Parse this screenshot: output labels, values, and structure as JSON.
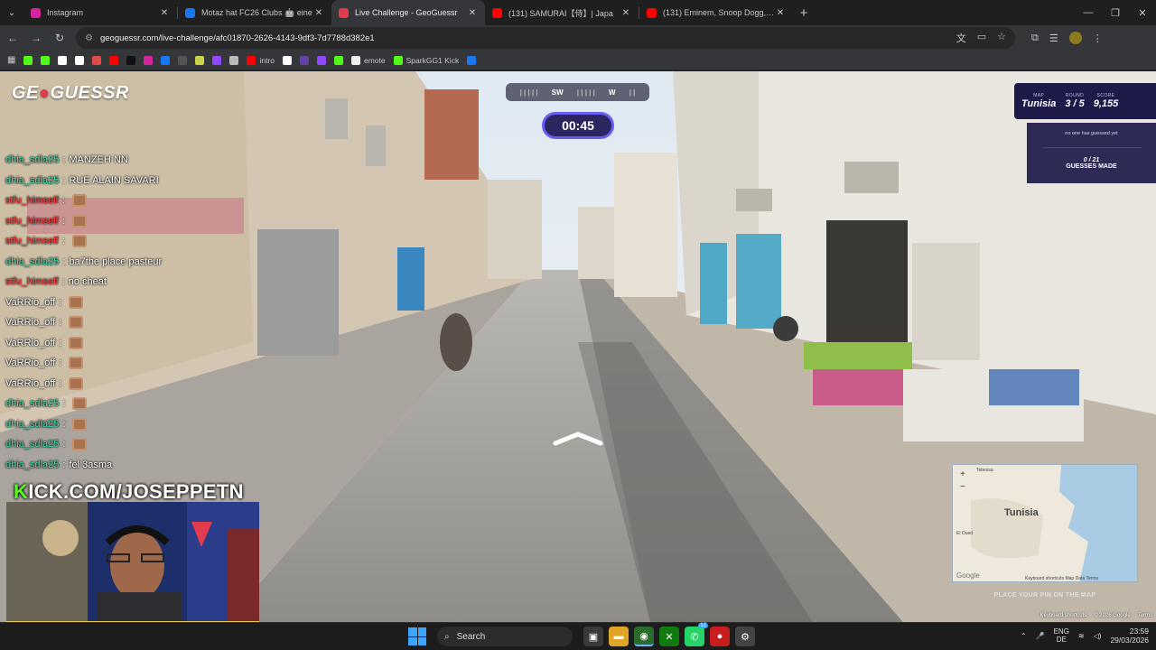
{
  "browser": {
    "tabs": [
      {
        "title": "Instagram",
        "favicon_color": "#d6249f",
        "active": false
      },
      {
        "title": "Motaz hat FC26 Clubs 🤖 eine",
        "favicon_color": "#1877f2",
        "active": false
      },
      {
        "title": "Live Challenge - GeoGuessr",
        "favicon_color": "#e23b4e",
        "active": true
      },
      {
        "title": "(131) SAMURAI【侍】| Japa",
        "favicon_color": "#ff0000",
        "active": false
      },
      {
        "title": "(131) Eminem, Snoop Dogg, 50",
        "favicon_color": "#ff0000",
        "active": false
      }
    ],
    "url": "geoguessr.com/live-challenge/afc01870-2626-4143-9df3-7d7788d382e1",
    "bookmarks": [
      {
        "label": "",
        "color": "#53fc18"
      },
      {
        "label": "",
        "color": "#53fc18"
      },
      {
        "label": "",
        "color": "#ffffff"
      },
      {
        "label": "",
        "color": "#ffffff"
      },
      {
        "label": "",
        "color": "#e04a4a"
      },
      {
        "label": "",
        "color": "#ff0000"
      },
      {
        "label": "",
        "color": "#111111"
      },
      {
        "label": "",
        "color": "#d6249f"
      },
      {
        "label": "",
        "color": "#1877f2"
      },
      {
        "label": "",
        "color": "#555555"
      },
      {
        "label": "",
        "color": "#cbd24b"
      },
      {
        "label": "",
        "color": "#9146ff"
      },
      {
        "label": "",
        "color": "#bbbbbb"
      },
      {
        "label": "intro",
        "color": "#ff0000"
      },
      {
        "label": "",
        "color": "#ffffff"
      },
      {
        "label": "",
        "color": "#6441a5"
      },
      {
        "label": "",
        "color": "#9146ff"
      },
      {
        "label": "",
        "color": "#53fc18"
      },
      {
        "label": "emote",
        "color": "#eeeeee"
      },
      {
        "label": "SparkGG1 Kick",
        "color": "#53fc18"
      },
      {
        "label": "",
        "color": "#1877f2"
      }
    ]
  },
  "game": {
    "logo_text_a": "GE",
    "logo_text_b": "GUESSR",
    "compass": {
      "ticks_left": "| | | | |",
      "label_1": "SW",
      "ticks_mid": "| | | | |",
      "label_2": "W",
      "ticks_right": "| |"
    },
    "timer": "00:45",
    "map_label": "MAP",
    "map_value": "Tunisia",
    "round_label": "ROUND",
    "round_value": "3 / 5",
    "score_label": "SCORE",
    "score_value": "9,155",
    "guess_note": "no one has guessed yet",
    "guess_count": "0 / 21",
    "guess_label": "GUESSES MADE",
    "minimap_country": "Tunisia",
    "minimap_place_1": "Tebessa",
    "minimap_place_2": "El Oued",
    "minimap_google": "Google",
    "minimap_footer": "Keyboard shortcuts   Map Data   Terms",
    "pin_prompt": "PLACE YOUR PIN ON THE MAP",
    "footer_links": [
      "Keyboard shortcuts",
      "© 2026 Google",
      "Terms"
    ]
  },
  "chat": [
    {
      "user": "dhia_sdla25",
      "color": "#38d9a9",
      "text": "MANZEH NN",
      "emote": false
    },
    {
      "user": "dhia_sdla25",
      "color": "#38d9a9",
      "text": "RUE ALAIN SAVARI",
      "emote": false
    },
    {
      "user": "stfu_himself",
      "color": "#ff3b3b",
      "text": "",
      "emote": true
    },
    {
      "user": "stfu_himself",
      "color": "#ff3b3b",
      "text": "",
      "emote": true
    },
    {
      "user": "stfu_himself",
      "color": "#ff3b3b",
      "text": "",
      "emote": true
    },
    {
      "user": "dhia_sdla25",
      "color": "#38d9a9",
      "text": "ba7the place pasteur",
      "emote": false
    },
    {
      "user": "stfu_himself",
      "color": "#ff3b3b",
      "text": "no cheat",
      "emote": false
    },
    {
      "user": "VaRRio_off",
      "color": "#ffffff",
      "text": "",
      "emote": true
    },
    {
      "user": "VaRRio_off",
      "color": "#ffffff",
      "text": "",
      "emote": true
    },
    {
      "user": "VaRRio_off",
      "color": "#ffffff",
      "text": "",
      "emote": true
    },
    {
      "user": "VaRRio_off",
      "color": "#ffffff",
      "text": "",
      "emote": true
    },
    {
      "user": "VaRRio_off",
      "color": "#ffffff",
      "text": "",
      "emote": true
    },
    {
      "user": "dhia_sdla25",
      "color": "#38d9a9",
      "text": "",
      "emote": true
    },
    {
      "user": "dhia_sdla25",
      "color": "#38d9a9",
      "text": "",
      "emote": true
    },
    {
      "user": "dhia_sdla25",
      "color": "#38d9a9",
      "text": "",
      "emote": true
    },
    {
      "user": "dhia_sdla25",
      "color": "#38d9a9",
      "text": "fel 3asma",
      "emote": false
    }
  ],
  "stream": {
    "kick_k": "K",
    "kick_rest": "ICK.COM/JOSEPPETN"
  },
  "taskbar": {
    "search_placeholder": "Search",
    "lang_1": "ENG",
    "lang_2": "DE",
    "time": "23:59",
    "date": "29/03/2026",
    "badge": "12"
  }
}
